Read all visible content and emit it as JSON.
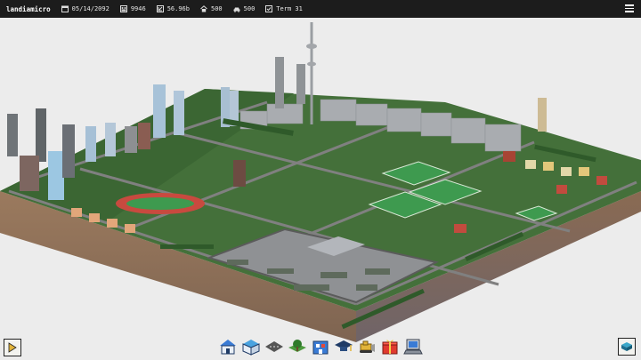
{
  "app": {
    "title": "landiamicro"
  },
  "stats": {
    "date": "05/14/2092",
    "population": "9946",
    "funds": "56.96b",
    "houses": "500",
    "vehicles": "500",
    "term": "Term 31"
  },
  "icons": {
    "date": "calendar-icon",
    "population": "population-icon",
    "funds": "money-icon",
    "houses": "house-icon",
    "vehicles": "car-icon",
    "term": "ballot-icon",
    "menu": "hamburger-menu-icon",
    "play": "play-icon",
    "map": "map-overview-icon"
  },
  "toolbar": [
    {
      "name": "residential-tool",
      "icon": "house-blue-icon"
    },
    {
      "name": "commercial-tool",
      "icon": "shop-icon"
    },
    {
      "name": "road-tool",
      "icon": "road-icon"
    },
    {
      "name": "park-tool",
      "icon": "tree-icon"
    },
    {
      "name": "education-tool",
      "icon": "school-icon"
    },
    {
      "name": "graduation-tool",
      "icon": "graduation-cap-icon"
    },
    {
      "name": "bulldoze-tool",
      "icon": "bulldozer-icon"
    },
    {
      "name": "gift-tool",
      "icon": "gift-icon"
    },
    {
      "name": "computer-tool",
      "icon": "computer-icon"
    }
  ],
  "colors": {
    "topbar": "#1c1c1c",
    "sky": "#ececec",
    "grass": "#3f6f35",
    "soil": "#8b6a4f",
    "road": "#7d7d7d"
  }
}
